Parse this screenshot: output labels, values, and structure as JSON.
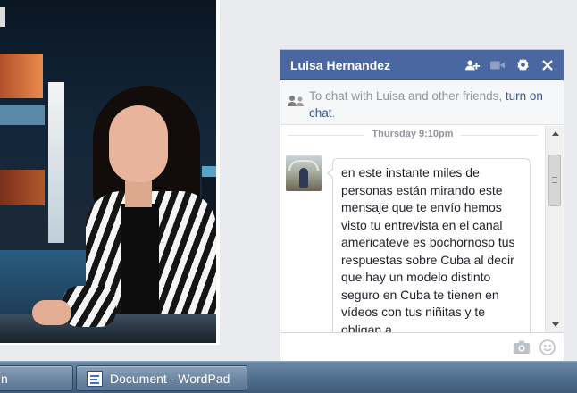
{
  "chat": {
    "title": "Luisa Hernandez",
    "notice_text": "To chat with Luisa and other friends,",
    "notice_link": "turn on chat",
    "notice_period": ".",
    "timestamp": "Thursday 9:10pm",
    "message": "en este instante miles de personas están mirando este mensaje que te envío hemos visto tu entrevista en el canal americateve es bochornoso tus respuestas sobre Cuba al decir que hay un modelo distinto seguro en Cuba te tienen en vídeos con tus niñitas y te obligan a"
  },
  "taskbar": {
    "items": [
      {
        "label": "n"
      },
      {
        "label": "Document - WordPad"
      }
    ]
  },
  "colors": {
    "header": "#4b67a1",
    "link": "#365899",
    "taskbar": "#52708f"
  },
  "icons": [
    "add-friend-icon",
    "video-call-icon",
    "gear-icon",
    "close-icon",
    "friends-icon",
    "camera-icon",
    "emoji-icon",
    "wordpad-icon"
  ]
}
